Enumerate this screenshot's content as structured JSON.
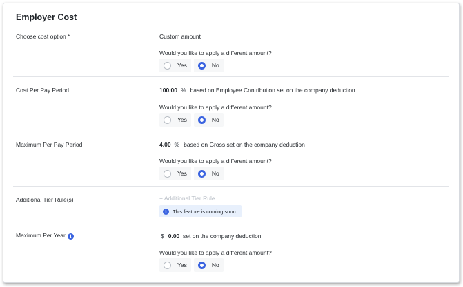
{
  "section_title": "Employer Cost",
  "question": "Would you like to apply a different amount?",
  "options": {
    "yes": "Yes",
    "no": "No"
  },
  "info_icon": "info-icon",
  "accent_color": "#3a63e0",
  "rows": {
    "cost_option": {
      "label": "Choose cost option *",
      "value": "Custom amount",
      "selected": "No"
    },
    "cost_per_pay_period": {
      "label": "Cost Per Pay Period",
      "amount": "100.00",
      "unit": "%",
      "description": "based on Employee Contribution set on the company deduction",
      "selected": "No"
    },
    "max_per_pay_period": {
      "label": "Maximum Per Pay Period",
      "amount": "4.00",
      "unit": "%",
      "description": "based on Gross set on the company deduction",
      "selected": "No"
    },
    "tier_rules": {
      "label": "Additional Tier Rule(s)",
      "link": "+ Additional Tier Rule",
      "notice": "This feature is coming soon."
    },
    "max_per_year": {
      "label": "Maximum Per Year",
      "currency": "$",
      "amount": "0.00",
      "description": "set on the company deduction",
      "selected": "No"
    }
  }
}
